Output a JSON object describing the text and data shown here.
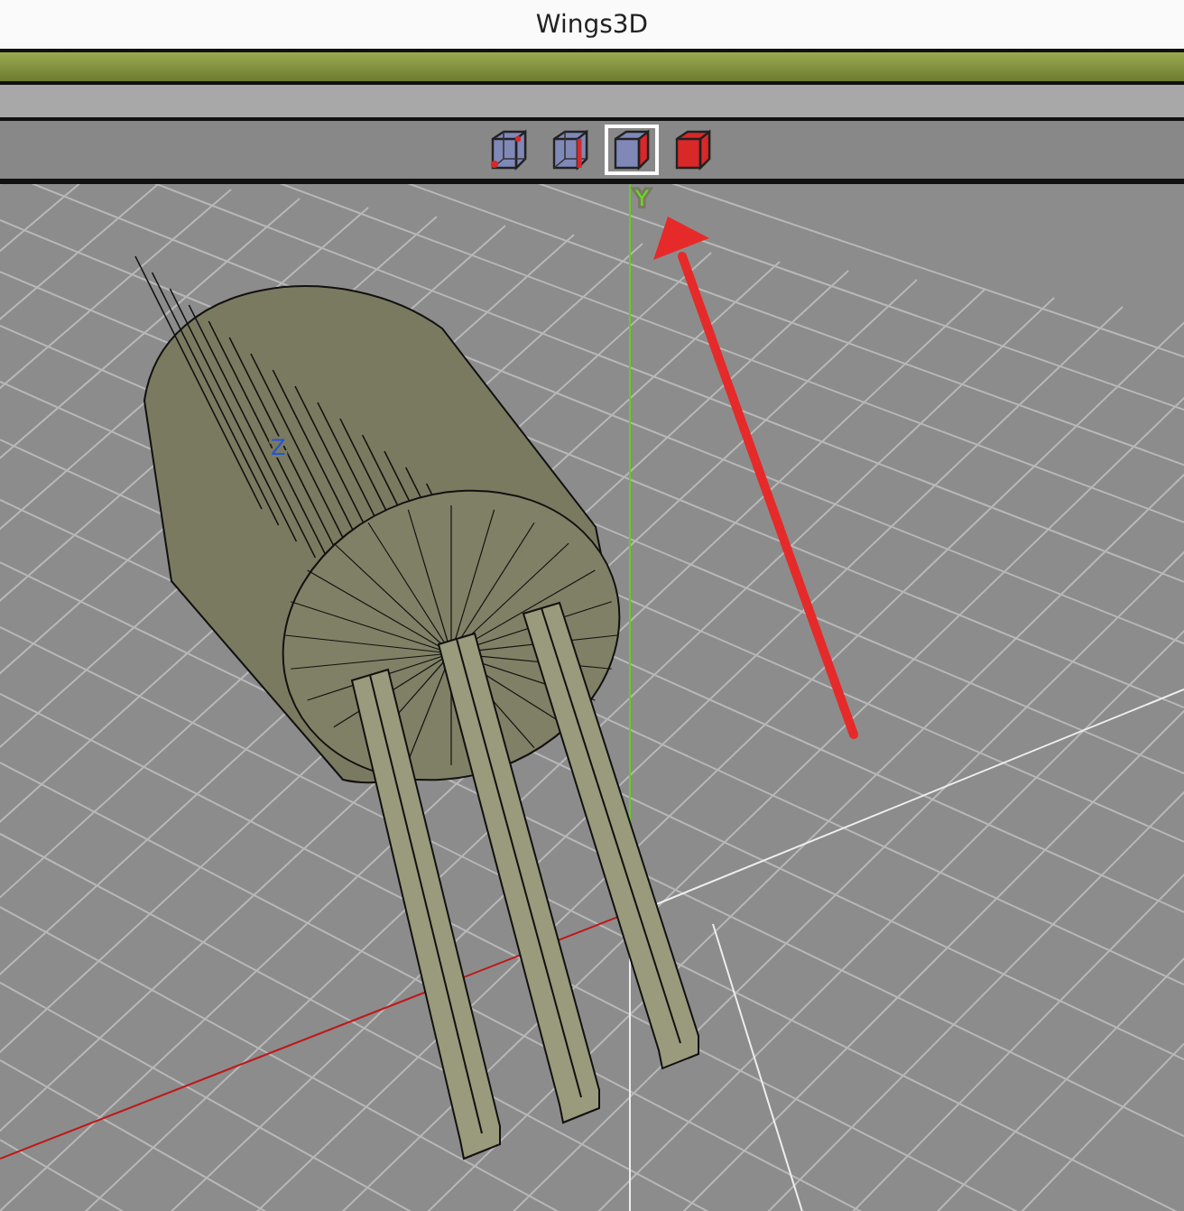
{
  "window": {
    "title": "Wings3D"
  },
  "selection_modes": [
    {
      "kind": "vertex",
      "selected": false
    },
    {
      "kind": "edge",
      "selected": false
    },
    {
      "kind": "face",
      "selected": true
    },
    {
      "kind": "body",
      "selected": false
    }
  ],
  "viewport": {
    "axis_labels": [
      {
        "kind": "y",
        "text": "Y"
      },
      {
        "kind": "z",
        "text": "Z"
      }
    ]
  }
}
